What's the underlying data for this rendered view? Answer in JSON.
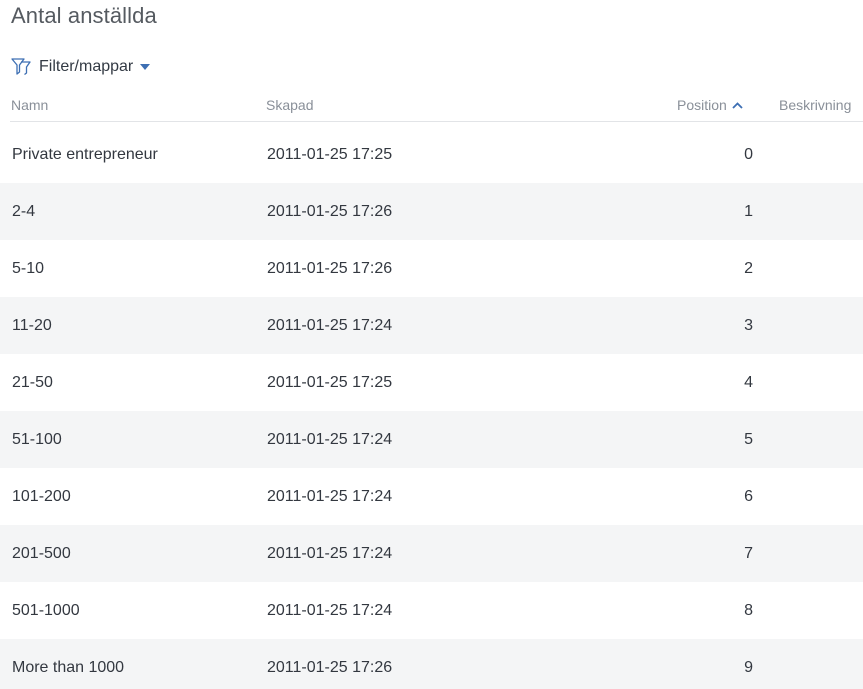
{
  "page": {
    "title": "Antal anställda"
  },
  "filter": {
    "label": "Filter/mappar",
    "icon": "filter-funnel-icon",
    "accent_color": "#3d6fb3"
  },
  "table": {
    "columns": {
      "name": "Namn",
      "created": "Skapad",
      "position": "Position",
      "description": "Beskrivning"
    },
    "sort": {
      "column": "position",
      "direction": "ascending"
    },
    "rows": [
      {
        "name": "Private entrepreneur",
        "created": "2011-01-25 17:25",
        "position": "0",
        "description": ""
      },
      {
        "name": "2-4",
        "created": "2011-01-25 17:26",
        "position": "1",
        "description": ""
      },
      {
        "name": "5-10",
        "created": "2011-01-25 17:26",
        "position": "2",
        "description": ""
      },
      {
        "name": "11-20",
        "created": "2011-01-25 17:24",
        "position": "3",
        "description": ""
      },
      {
        "name": "21-50",
        "created": "2011-01-25 17:25",
        "position": "4",
        "description": ""
      },
      {
        "name": "51-100",
        "created": "2011-01-25 17:24",
        "position": "5",
        "description": ""
      },
      {
        "name": "101-200",
        "created": "2011-01-25 17:24",
        "position": "6",
        "description": ""
      },
      {
        "name": "201-500",
        "created": "2011-01-25 17:24",
        "position": "7",
        "description": ""
      },
      {
        "name": "501-1000",
        "created": "2011-01-25 17:24",
        "position": "8",
        "description": ""
      },
      {
        "name": "More than 1000",
        "created": "2011-01-25 17:26",
        "position": "9",
        "description": ""
      }
    ]
  }
}
